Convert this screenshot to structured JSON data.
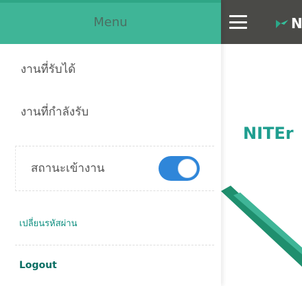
{
  "drawer": {
    "title": "Menu",
    "items": [
      {
        "label": "งานที่รับได้"
      },
      {
        "label": "งานที่กำลังรับ"
      }
    ],
    "status_toggle": {
      "label": "สถานะเข้างาน",
      "on": true
    },
    "change_password": "เปลี่ยนรหัสผ่าน",
    "logout": "Logout"
  },
  "app": {
    "brand_text": "N",
    "title": "NITEr"
  },
  "colors": {
    "drawer_header": "#3fb597",
    "app_header": "#4a4a47",
    "accent": "#1f9e8f",
    "toggle_on": "#2f86d9",
    "link": "#0f8f80"
  },
  "icons": {
    "menu": "hamburger-icon",
    "brand": "brand-logo-icon"
  }
}
